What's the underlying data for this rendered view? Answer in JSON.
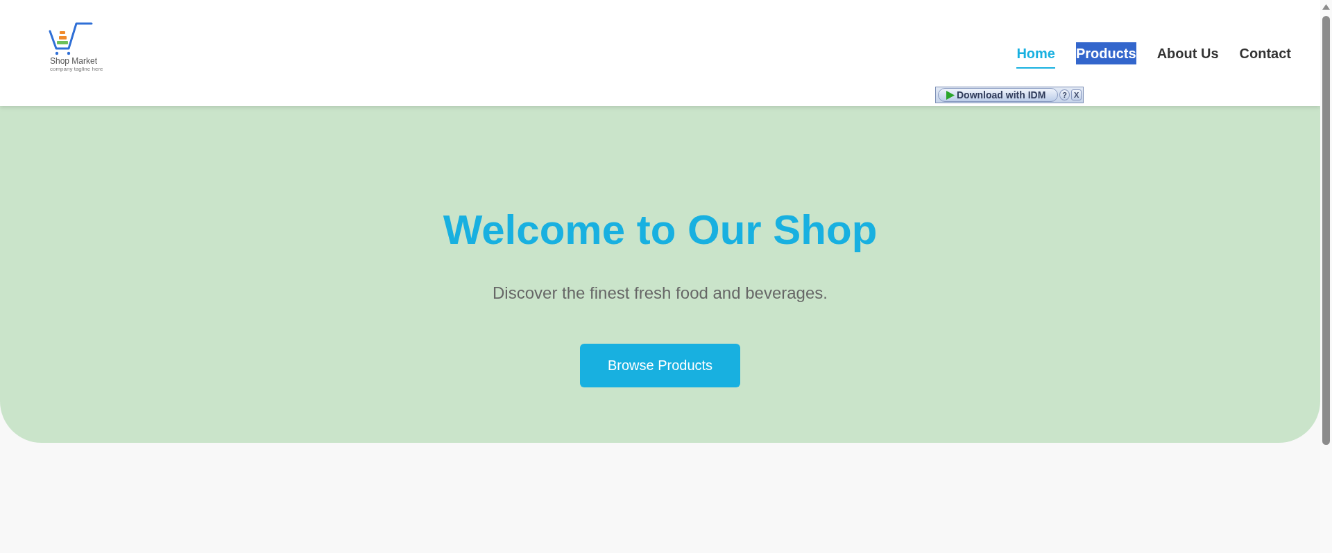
{
  "logo": {
    "name": "Shop Market",
    "tagline": "company tagline here"
  },
  "nav": {
    "items": [
      {
        "label": "Home",
        "selected": true,
        "highlighted": false
      },
      {
        "label": "Products",
        "selected": false,
        "highlighted": true
      },
      {
        "label": "About Us",
        "selected": false,
        "highlighted": false
      },
      {
        "label": "Contact",
        "selected": false,
        "highlighted": false
      }
    ]
  },
  "download_panel": {
    "button": "Download with IDM",
    "help": "?",
    "close": "X"
  },
  "hero": {
    "title": "Welcome to Our Shop",
    "subtitle": "Discover the finest fresh food and beverages.",
    "button": "Browse Products"
  }
}
